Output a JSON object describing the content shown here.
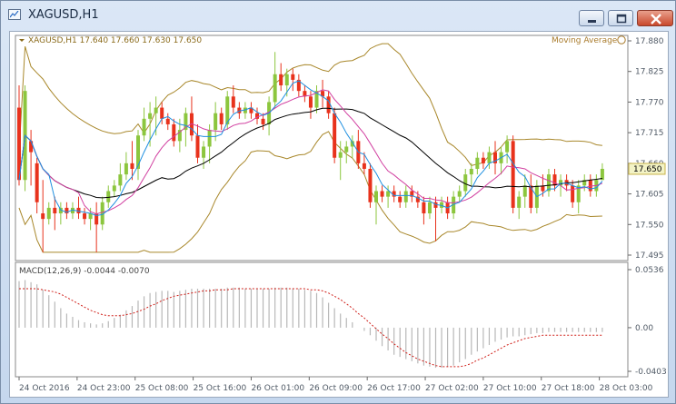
{
  "window": {
    "title": "XAGUSD,H1",
    "buttons": [
      "minimize",
      "maximize",
      "close"
    ]
  },
  "chart_data": [
    {
      "type": "candlestick",
      "symbol": "XAGUSD",
      "timeframe": "H1",
      "header": "XAGUSD,H1  17.640 17.660 17.630 17.650",
      "indicator_label": "Moving Average",
      "y_ticks": [
        "17.880",
        "17.825",
        "17.770",
        "17.715",
        "17.660",
        "17.605",
        "17.550",
        "17.495"
      ],
      "ylim": [
        17.495,
        17.88
      ],
      "current_price": "17.650",
      "x_ticks": [
        "24 Oct 2016",
        "24 Oct 23:00",
        "25 Oct 08:00",
        "25 Oct 16:00",
        "26 Oct 01:00",
        "26 Oct 09:00",
        "26 Oct 17:00",
        "27 Oct 02:00",
        "27 Oct 10:00",
        "27 Oct 18:00",
        "28 Oct 03:00"
      ],
      "colors": {
        "bull": "#8cc63e",
        "bear": "#e8321c",
        "ma_slow": "#000000",
        "ma_mid": "#d13fa0",
        "ma_fast": "#1e8fe0",
        "bands": "#a8872a"
      },
      "candles": [
        [
          17.76,
          17.8,
          17.62,
          17.63
        ],
        [
          17.63,
          17.8,
          17.61,
          17.79
        ],
        [
          17.7,
          17.72,
          17.62,
          17.68
        ],
        [
          17.66,
          17.67,
          17.57,
          17.59
        ],
        [
          17.57,
          17.63,
          17.5,
          17.56
        ],
        [
          17.56,
          17.59,
          17.55,
          17.58
        ],
        [
          17.58,
          17.6,
          17.54,
          17.57
        ],
        [
          17.57,
          17.59,
          17.55,
          17.58
        ],
        [
          17.58,
          17.59,
          17.56,
          17.57
        ],
        [
          17.57,
          17.59,
          17.56,
          17.58
        ],
        [
          17.58,
          17.6,
          17.56,
          17.57
        ],
        [
          17.57,
          17.58,
          17.55,
          17.56
        ],
        [
          17.56,
          17.58,
          17.54,
          17.57
        ],
        [
          17.57,
          17.59,
          17.5,
          17.55
        ],
        [
          17.55,
          17.6,
          17.54,
          17.59
        ],
        [
          17.59,
          17.62,
          17.58,
          17.61
        ],
        [
          17.61,
          17.63,
          17.6,
          17.62
        ],
        [
          17.62,
          17.66,
          17.61,
          17.64
        ],
        [
          17.64,
          17.68,
          17.63,
          17.66
        ],
        [
          17.66,
          17.7,
          17.63,
          17.65
        ],
        [
          17.65,
          17.72,
          17.63,
          17.71
        ],
        [
          17.71,
          17.76,
          17.7,
          17.74
        ],
        [
          17.74,
          17.77,
          17.69,
          17.75
        ],
        [
          17.75,
          17.78,
          17.71,
          17.76
        ],
        [
          17.76,
          17.77,
          17.73,
          17.74
        ],
        [
          17.74,
          17.75,
          17.72,
          17.73
        ],
        [
          17.73,
          17.74,
          17.69,
          17.7
        ],
        [
          17.7,
          17.74,
          17.68,
          17.72
        ],
        [
          17.72,
          17.76,
          17.69,
          17.75
        ],
        [
          17.75,
          17.78,
          17.7,
          17.71
        ],
        [
          17.71,
          17.73,
          17.66,
          17.67
        ],
        [
          17.67,
          17.7,
          17.65,
          17.69
        ],
        [
          17.69,
          17.73,
          17.66,
          17.72
        ],
        [
          17.72,
          17.77,
          17.7,
          17.75
        ],
        [
          17.75,
          17.76,
          17.72,
          17.73
        ],
        [
          17.73,
          17.79,
          17.72,
          17.78
        ],
        [
          17.78,
          17.8,
          17.75,
          17.76
        ],
        [
          17.76,
          17.77,
          17.74,
          17.75
        ],
        [
          17.75,
          17.77,
          17.74,
          17.76
        ],
        [
          17.76,
          17.77,
          17.74,
          17.75
        ],
        [
          17.75,
          17.76,
          17.73,
          17.74
        ],
        [
          17.74,
          17.75,
          17.72,
          17.73
        ],
        [
          17.73,
          17.78,
          17.71,
          17.77
        ],
        [
          17.77,
          17.86,
          17.76,
          17.82
        ],
        [
          17.82,
          17.84,
          17.79,
          17.8
        ],
        [
          17.8,
          17.83,
          17.78,
          17.82
        ],
        [
          17.82,
          17.83,
          17.79,
          17.81
        ],
        [
          17.81,
          17.82,
          17.78,
          17.79
        ],
        [
          17.79,
          17.8,
          17.77,
          17.78
        ],
        [
          17.78,
          17.79,
          17.74,
          17.76
        ],
        [
          17.76,
          17.8,
          17.75,
          17.79
        ],
        [
          17.79,
          17.81,
          17.76,
          17.78
        ],
        [
          17.78,
          17.79,
          17.74,
          17.75
        ],
        [
          17.75,
          17.76,
          17.66,
          17.67
        ],
        [
          17.67,
          17.7,
          17.63,
          17.68
        ],
        [
          17.68,
          17.7,
          17.66,
          17.69
        ],
        [
          17.69,
          17.71,
          17.67,
          17.7
        ],
        [
          17.7,
          17.72,
          17.65,
          17.66
        ],
        [
          17.66,
          17.68,
          17.64,
          17.65
        ],
        [
          17.65,
          17.66,
          17.58,
          17.59
        ],
        [
          17.59,
          17.62,
          17.55,
          17.61
        ],
        [
          17.61,
          17.62,
          17.59,
          17.6
        ],
        [
          17.6,
          17.62,
          17.58,
          17.61
        ],
        [
          17.61,
          17.62,
          17.59,
          17.6
        ],
        [
          17.6,
          17.61,
          17.58,
          17.59
        ],
        [
          17.59,
          17.62,
          17.58,
          17.61
        ],
        [
          17.61,
          17.62,
          17.59,
          17.6
        ],
        [
          17.6,
          17.61,
          17.58,
          17.59
        ],
        [
          17.59,
          17.6,
          17.55,
          17.57
        ],
        [
          17.57,
          17.6,
          17.56,
          17.59
        ],
        [
          17.59,
          17.6,
          17.52,
          17.58
        ],
        [
          17.58,
          17.6,
          17.57,
          17.59
        ],
        [
          17.59,
          17.6,
          17.56,
          17.57
        ],
        [
          17.57,
          17.61,
          17.56,
          17.6
        ],
        [
          17.6,
          17.62,
          17.59,
          17.61
        ],
        [
          17.61,
          17.65,
          17.6,
          17.64
        ],
        [
          17.64,
          17.66,
          17.62,
          17.65
        ],
        [
          17.65,
          17.68,
          17.64,
          17.67
        ],
        [
          17.67,
          17.68,
          17.65,
          17.66
        ],
        [
          17.66,
          17.69,
          17.65,
          17.68
        ],
        [
          17.68,
          17.7,
          17.64,
          17.66
        ],
        [
          17.66,
          17.69,
          17.64,
          17.68
        ],
        [
          17.68,
          17.71,
          17.66,
          17.7
        ],
        [
          17.7,
          17.71,
          17.57,
          17.58
        ],
        [
          17.58,
          17.61,
          17.56,
          17.6
        ],
        [
          17.6,
          17.64,
          17.58,
          17.62
        ],
        [
          17.62,
          17.64,
          17.57,
          17.58
        ],
        [
          17.58,
          17.63,
          17.57,
          17.62
        ],
        [
          17.62,
          17.64,
          17.6,
          17.61
        ],
        [
          17.61,
          17.65,
          17.6,
          17.64
        ],
        [
          17.64,
          17.65,
          17.61,
          17.62
        ],
        [
          17.62,
          17.64,
          17.6,
          17.63
        ],
        [
          17.63,
          17.64,
          17.61,
          17.62
        ],
        [
          17.62,
          17.63,
          17.58,
          17.59
        ],
        [
          17.59,
          17.63,
          17.57,
          17.62
        ],
        [
          17.62,
          17.64,
          17.61,
          17.63
        ],
        [
          17.63,
          17.64,
          17.6,
          17.61
        ],
        [
          17.61,
          17.64,
          17.6,
          17.63
        ],
        [
          17.63,
          17.66,
          17.63,
          17.65
        ]
      ]
    },
    {
      "type": "histogram",
      "label": "MACD(12,26,9) -0.0044 -0.0070",
      "y_ticks": [
        "0.0536",
        "0.00",
        "-0.0403"
      ],
      "ylim": [
        -0.0403,
        0.0536
      ],
      "values": [
        0.043,
        0.044,
        0.042,
        0.04,
        0.035,
        0.03,
        0.024,
        0.018,
        0.013,
        0.01,
        0.007,
        0.005,
        0.004,
        0.003,
        0.004,
        0.006,
        0.009,
        0.012,
        0.016,
        0.02,
        0.025,
        0.029,
        0.032,
        0.033,
        0.034,
        0.034,
        0.033,
        0.034,
        0.035,
        0.036,
        0.036,
        0.036,
        0.036,
        0.036,
        0.036,
        0.037,
        0.037,
        0.037,
        0.036,
        0.036,
        0.036,
        0.036,
        0.036,
        0.037,
        0.037,
        0.037,
        0.036,
        0.036,
        0.035,
        0.034,
        0.032,
        0.028,
        0.023,
        0.018,
        0.013,
        0.009,
        0.005,
        0.0,
        -0.003,
        -0.007,
        -0.012,
        -0.017,
        -0.021,
        -0.025,
        -0.027,
        -0.029,
        -0.031,
        -0.033,
        -0.035,
        -0.036,
        -0.037,
        -0.037,
        -0.036,
        -0.035,
        -0.032,
        -0.029,
        -0.025,
        -0.022,
        -0.019,
        -0.016,
        -0.013,
        -0.011,
        -0.009,
        -0.008,
        -0.008,
        -0.007,
        -0.006,
        -0.005,
        -0.005,
        -0.004,
        -0.004,
        -0.004,
        -0.004,
        -0.004,
        -0.004,
        -0.004,
        -0.004,
        -0.004,
        -0.004
      ],
      "signal": [
        0.036,
        0.036,
        0.036,
        0.036,
        0.035,
        0.034,
        0.033,
        0.031,
        0.028,
        0.025,
        0.022,
        0.019,
        0.016,
        0.014,
        0.012,
        0.011,
        0.011,
        0.011,
        0.012,
        0.013,
        0.015,
        0.017,
        0.02,
        0.022,
        0.025,
        0.027,
        0.029,
        0.03,
        0.031,
        0.032,
        0.033,
        0.034,
        0.034,
        0.035,
        0.035,
        0.035,
        0.036,
        0.036,
        0.036,
        0.036,
        0.036,
        0.036,
        0.036,
        0.036,
        0.036,
        0.036,
        0.036,
        0.036,
        0.036,
        0.035,
        0.035,
        0.034,
        0.032,
        0.029,
        0.026,
        0.022,
        0.018,
        0.013,
        0.009,
        0.004,
        -0.001,
        -0.006,
        -0.01,
        -0.015,
        -0.019,
        -0.023,
        -0.026,
        -0.029,
        -0.031,
        -0.033,
        -0.035,
        -0.036,
        -0.036,
        -0.036,
        -0.036,
        -0.035,
        -0.033,
        -0.03,
        -0.028,
        -0.025,
        -0.022,
        -0.019,
        -0.016,
        -0.014,
        -0.012,
        -0.01,
        -0.009,
        -0.008,
        -0.007,
        -0.007,
        -0.007,
        -0.007,
        -0.007,
        -0.007,
        -0.007,
        -0.007,
        -0.007,
        -0.007,
        -0.007
      ]
    }
  ]
}
